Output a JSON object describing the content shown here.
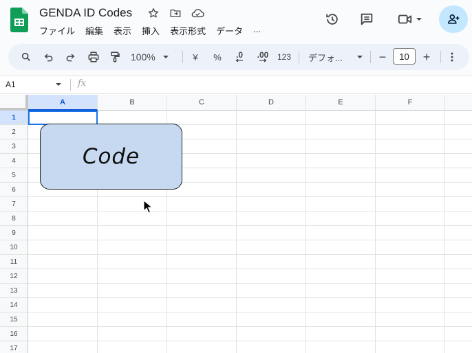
{
  "app": {
    "doc_title": "GENDA ID Codes",
    "menus": [
      "ファイル",
      "編集",
      "表示",
      "挿入",
      "表示形式",
      "データ",
      "..."
    ]
  },
  "toolbar": {
    "zoom": "100%",
    "currency": "¥",
    "percent": "%",
    "decimal_decrease": ".0",
    "decimal_increase": ".00",
    "number_format": "123",
    "font_name": "デフォ...",
    "font_size": "10",
    "font_size_minus": "−",
    "font_size_plus": "+"
  },
  "formula_bar": {
    "cell_ref": "A1",
    "fx_label": "fx",
    "value": ""
  },
  "grid": {
    "columns": [
      "A",
      "B",
      "C",
      "D",
      "E",
      "F"
    ],
    "rows": [
      "1",
      "2",
      "3",
      "4",
      "5",
      "6",
      "7",
      "8",
      "9",
      "10",
      "11",
      "12",
      "13",
      "14",
      "15",
      "16",
      "17"
    ],
    "selected_column": "A",
    "selected_row": "1"
  },
  "drawing": {
    "text": "Code",
    "fill_color": "#c6d9f1"
  },
  "colors": {
    "accent": "#0b57d0",
    "share_button": "#c2e7ff",
    "sheets_green": "#0f9d58"
  }
}
